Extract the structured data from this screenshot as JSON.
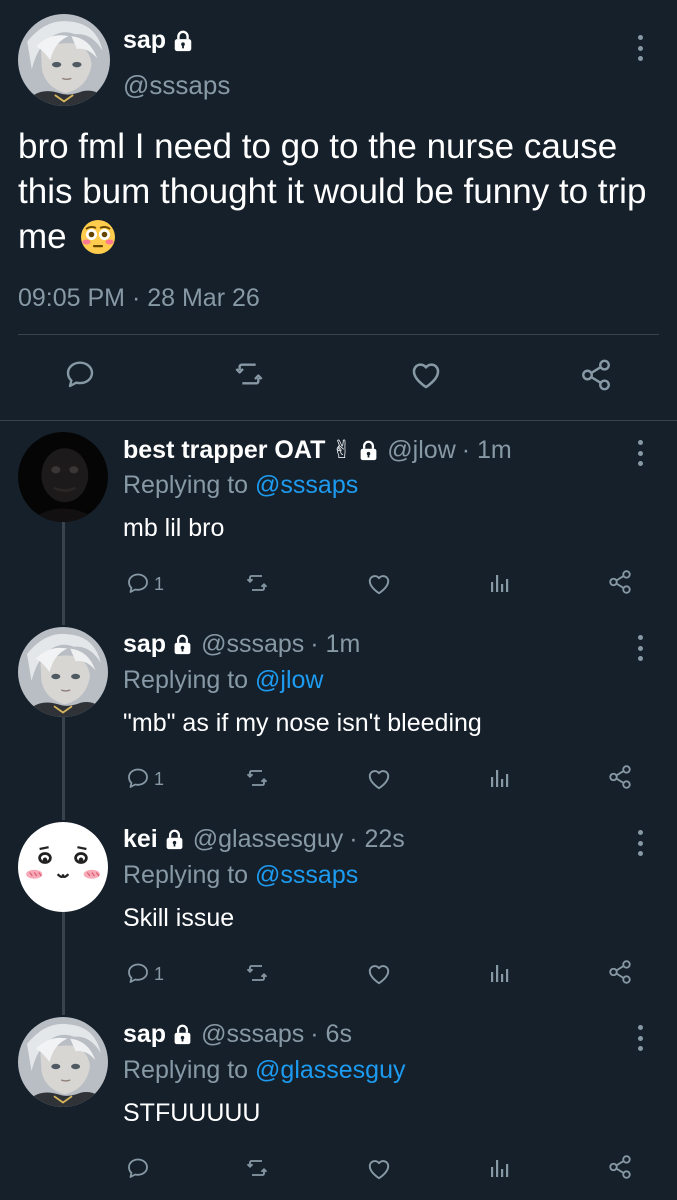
{
  "main_tweet": {
    "author_name": "sap",
    "handle": "@sssaps",
    "text": "bro fml I need to go to the nurse cause this bum thought it would be funny to trip me",
    "emoji": "flushed-face",
    "timestamp": "09:05 PM · 28 Mar 26",
    "actions": [
      "reply-icon",
      "retweet-icon",
      "like-icon",
      "share-icon"
    ]
  },
  "replies": [
    {
      "author_name": "best trapper OAT",
      "name_emoji": "✌",
      "handle": "@jlow",
      "time": "· 1m",
      "replying_prefix": "Replying to",
      "replying_to": "@sssaps",
      "text": "mb lil bro",
      "reply_count": "1",
      "avatar": "dark-figure"
    },
    {
      "author_name": "sap",
      "name_emoji": "",
      "handle": "@sssaps",
      "time": "· 1m",
      "replying_prefix": "Replying to",
      "replying_to": "@jlow",
      "text": "\"mb\" as if my nose isn't bleeding",
      "reply_count": "1",
      "avatar": "anime-boy"
    },
    {
      "author_name": "kei",
      "name_emoji": "",
      "handle": "@glassesguy",
      "time": "· 22s",
      "replying_prefix": "Replying to",
      "replying_to": "@sssaps",
      "text": "Skill issue",
      "reply_count": "1",
      "avatar": "cute-face"
    },
    {
      "author_name": "sap",
      "name_emoji": "",
      "handle": "@sssaps",
      "time": "· 6s",
      "replying_prefix": "Replying to",
      "replying_to": "@glassesguy",
      "text": "STFUUUUU",
      "reply_count": "",
      "avatar": "anime-boy"
    }
  ],
  "colors": {
    "background": "#15202b",
    "secondary_text": "#8899a6",
    "link": "#1d9bf0",
    "divider": "#38444d"
  }
}
